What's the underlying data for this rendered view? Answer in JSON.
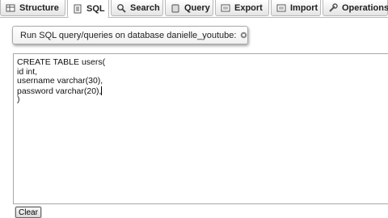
{
  "tabs": [
    {
      "label": "Structure",
      "icon": "structure-icon",
      "active": false
    },
    {
      "label": "SQL",
      "icon": "sql-icon",
      "active": true
    },
    {
      "label": "Search",
      "icon": "search-icon",
      "active": false
    },
    {
      "label": "Query",
      "icon": "query-icon",
      "active": false
    },
    {
      "label": "Export",
      "icon": "export-icon",
      "active": false
    },
    {
      "label": "Import",
      "icon": "import-icon",
      "active": false
    },
    {
      "label": "Operations",
      "icon": "operations-icon",
      "active": false
    }
  ],
  "sql_panel": {
    "legend": "Run SQL query/queries on database danielle_youtube:",
    "help_icon": "help-icon",
    "query_lines": [
      "CREATE TABLE users(",
      "id int,",
      "username varchar(30),",
      "password varchar(20),",
      ")"
    ],
    "clear_label": "Clear"
  },
  "colors": {
    "tab_border": "#b9b9b9",
    "tab_gradient_bottom": "#e4e4e4",
    "box_border": "#a8a8a8"
  }
}
